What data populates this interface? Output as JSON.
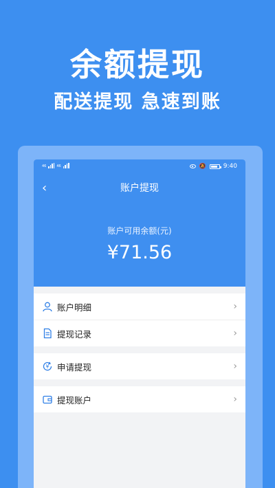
{
  "promo": {
    "title": "余额提现",
    "subtitle": "配送提现 急速到账"
  },
  "status_bar": {
    "time": "9:40",
    "network_left": "46",
    "network_right": "46"
  },
  "nav": {
    "back_icon": "chevron-left-icon",
    "back_glyph": "‹",
    "title": "账户提现"
  },
  "balance": {
    "label": "账户可用余额(元)",
    "amount": "¥71.56"
  },
  "menu": [
    {
      "label": "账户明细",
      "icon": "user-icon"
    },
    {
      "label": "提现记录",
      "icon": "document-icon"
    },
    {
      "label": "申请提现",
      "icon": "yen-refresh-icon"
    },
    {
      "label": "提现账户",
      "icon": "wallet-icon"
    }
  ],
  "chevron_glyph": "›",
  "colors": {
    "background": "#3d8ff0",
    "frame": "#7db4f9",
    "header": "#3f8ff0",
    "icon": "#2f7fe6"
  }
}
